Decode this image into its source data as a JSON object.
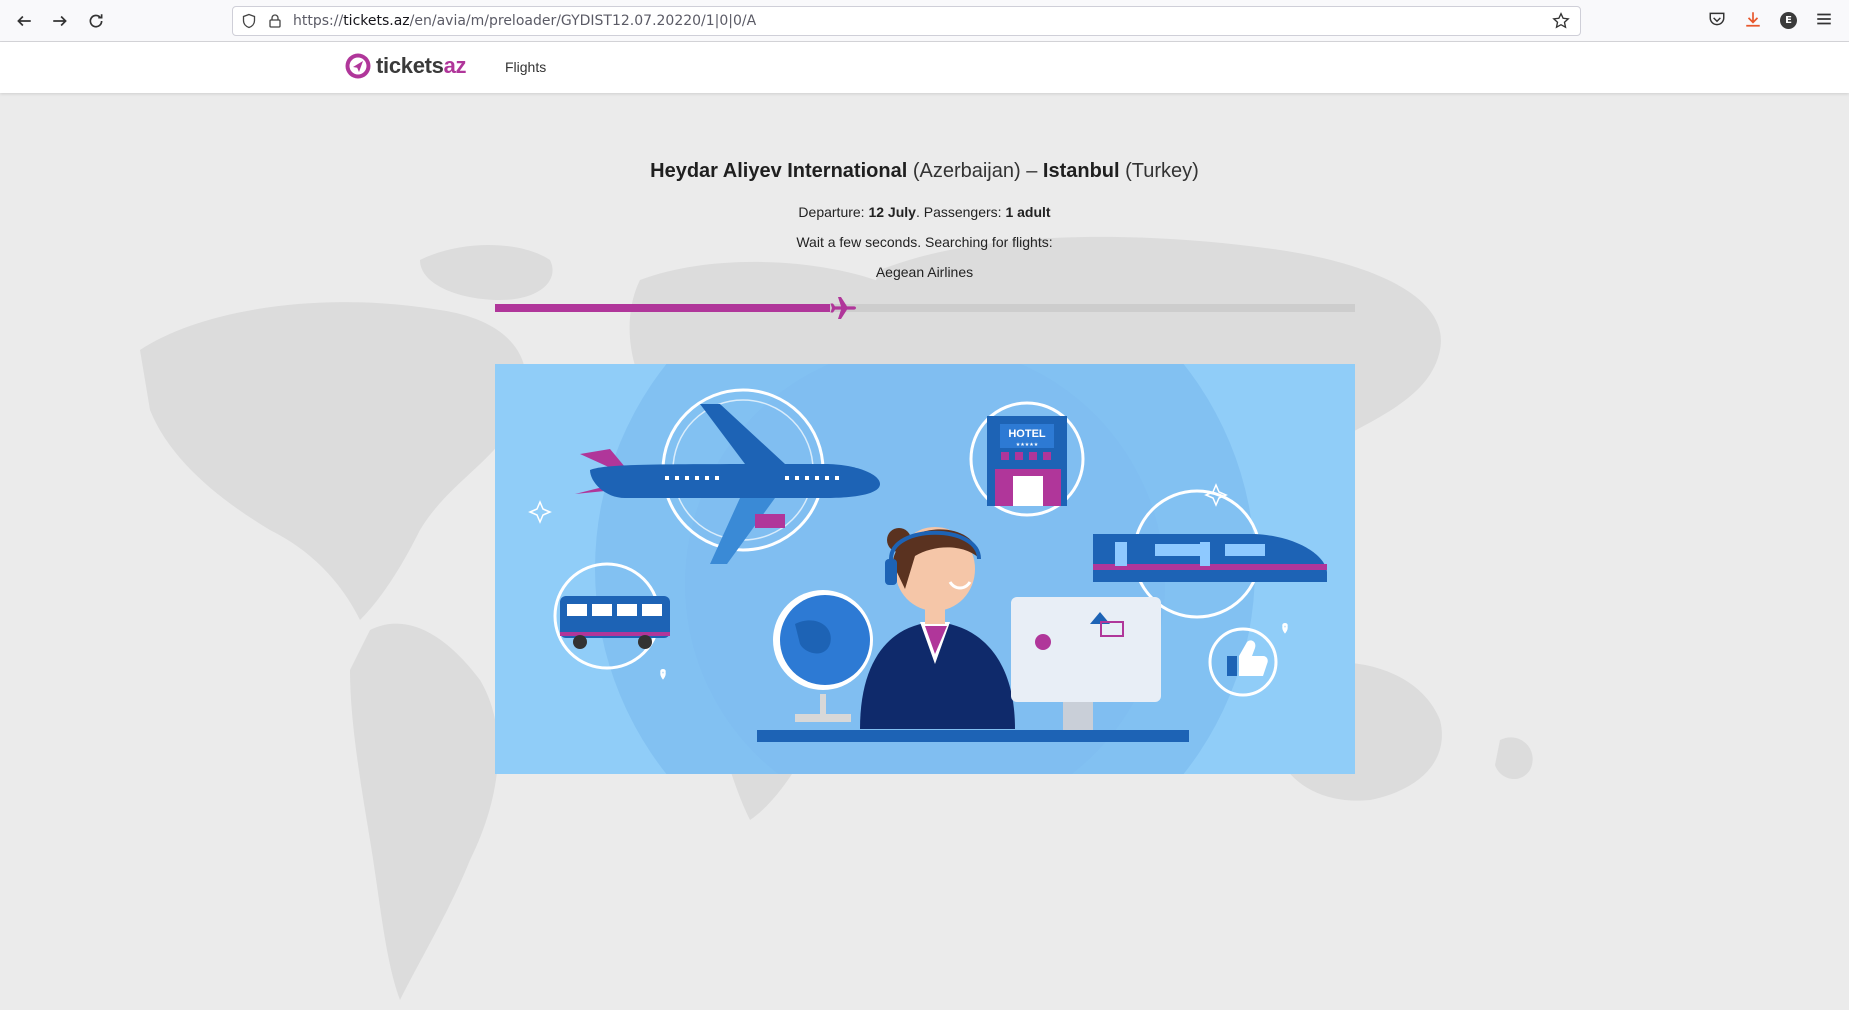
{
  "browser": {
    "url_prefix": "https://",
    "url_host": "tickets.az",
    "url_path": "/en/avia/m/preloader/GYDIST12.07.20220/1|0|0/A",
    "profile_initial": "E"
  },
  "header": {
    "logo_main": "tickets",
    "logo_accent": "az",
    "nav_flights": "Flights"
  },
  "search": {
    "origin_name": "Heydar Aliyev International",
    "origin_country": "(Azerbaijan)",
    "separator": "–",
    "destination_name": "Istanbul",
    "destination_country": "(Turkey)",
    "departure_label": "Departure:",
    "departure_date": "12 July",
    "passengers_label": "Passengers:",
    "passengers_value": "1 adult",
    "wait_text": "Wait a few seconds. Searching for flights:",
    "current_airline": "Aegean Airlines",
    "progress_fraction": 0.39
  },
  "illustration": {
    "hotel_sign": "HOTEL",
    "hotel_stars": "★★★★★"
  },
  "colors": {
    "accent": "#b0369a",
    "illustration_bg": "#90cdf8",
    "blue_dark": "#1d63b5"
  }
}
